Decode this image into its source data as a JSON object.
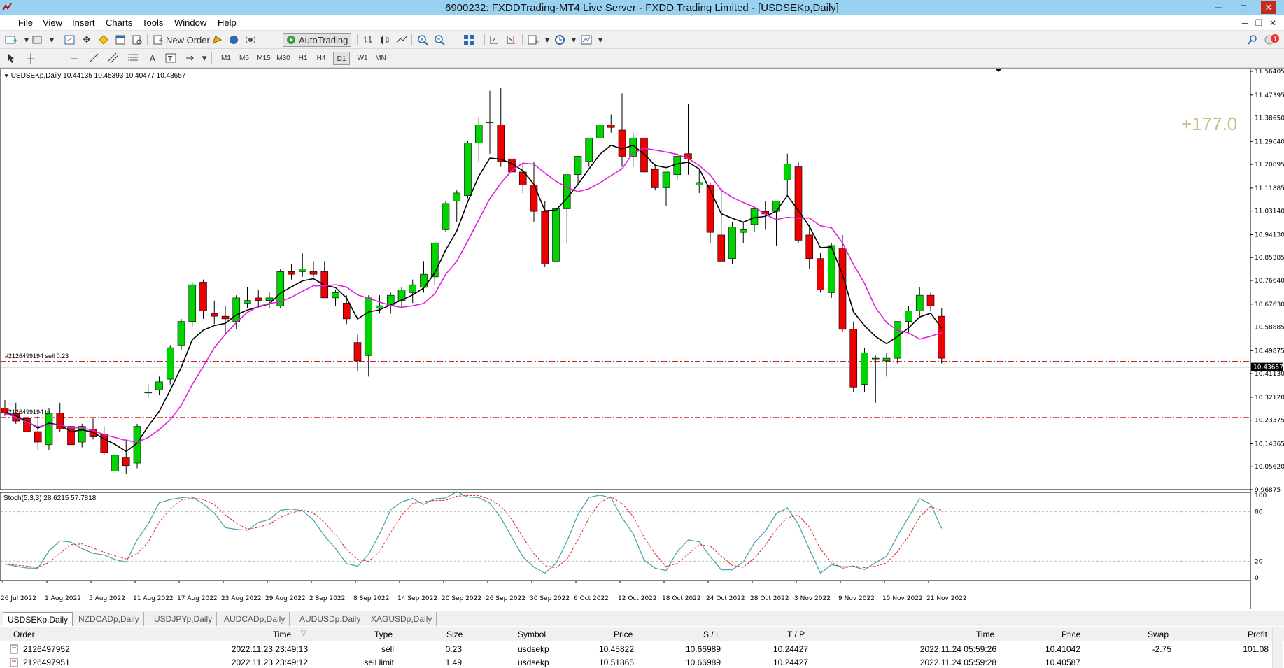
{
  "window": {
    "title": "6900232: FXDDTrading-MT4 Live Server - FXDD Trading Limited - [USDSEKp,Daily]"
  },
  "menu": [
    "File",
    "View",
    "Insert",
    "Charts",
    "Tools",
    "Window",
    "Help"
  ],
  "toolbar": {
    "new_order": "New Order",
    "autotrading": "AutoTrading"
  },
  "timeframes": [
    "M1",
    "M5",
    "M15",
    "M30",
    "H1",
    "H4",
    "D1",
    "W1",
    "MN"
  ],
  "active_timeframe": "D1",
  "chart": {
    "symbol_info": "USDSEKp,Daily  10.44135 10.45393 10.40477 10.43657",
    "profit_overlay": "+177.0",
    "order_line_label": "#2126499194 sell 0.23",
    "tp_line_label": "#2126499194 tp",
    "current_price": "10.43657",
    "price_axis": [
      "11.56405",
      "11.47395",
      "11.38650",
      "11.29640",
      "11.20895",
      "11.11885",
      "11.03140",
      "10.94130",
      "10.85385",
      "10.76640",
      "10.67630",
      "10.58885",
      "10.49875",
      "10.41130",
      "10.32120",
      "10.23375",
      "10.14365",
      "10.05620",
      "9.96875"
    ],
    "date_axis": [
      "26 Jul 2022",
      "1 Aug 2022",
      "5 Aug 2022",
      "11 Aug 2022",
      "17 Aug 2022",
      "23 Aug 2022",
      "29 Aug 2022",
      "2 Sep 2022",
      "8 Sep 2022",
      "14 Sep 2022",
      "20 Sep 2022",
      "26 Sep 2022",
      "30 Sep 2022",
      "6 Oct 2022",
      "12 Oct 2022",
      "18 Oct 2022",
      "24 Oct 2022",
      "28 Oct 2022",
      "3 Nov 2022",
      "9 Nov 2022",
      "15 Nov 2022",
      "21 Nov 2022"
    ],
    "stoch_label": "Stoch(5,3,3) 28.6215 57.7818",
    "stoch_axis": [
      "100",
      "80",
      "20",
      "0"
    ],
    "colors": {
      "bull": "#00d400",
      "bear": "#ee0000",
      "ma_fast": "#000000",
      "ma_slow": "#e020e0",
      "stoch_main": "#44a0a8",
      "stoch_signal": "#dd2222",
      "order_line": "#cc2222"
    }
  },
  "chart_data": {
    "type": "candlestick",
    "symbol": "USDSEKp",
    "timeframe": "Daily",
    "ylim": [
      9.96875,
      11.56405
    ],
    "bull_color": "#00d400",
    "bear_color": "#ee0000",
    "ohlc": [
      [
        10.28,
        10.31,
        10.25,
        10.26
      ],
      [
        10.26,
        10.3,
        10.22,
        10.23
      ],
      [
        10.24,
        10.28,
        10.18,
        10.19
      ],
      [
        10.19,
        10.25,
        10.12,
        10.15
      ],
      [
        10.14,
        10.28,
        10.12,
        10.26
      ],
      [
        10.26,
        10.3,
        10.19,
        10.2
      ],
      [
        10.21,
        10.26,
        10.13,
        10.14
      ],
      [
        10.15,
        10.22,
        10.13,
        10.21
      ],
      [
        10.2,
        10.24,
        10.16,
        10.17
      ],
      [
        10.18,
        10.21,
        10.1,
        10.11
      ],
      [
        10.04,
        10.12,
        10.02,
        10.1
      ],
      [
        10.09,
        10.16,
        10.03,
        10.06
      ],
      [
        10.07,
        10.22,
        10.05,
        10.21
      ],
      [
        10.34,
        10.37,
        10.32,
        10.34
      ],
      [
        10.35,
        10.4,
        10.33,
        10.38
      ],
      [
        10.39,
        10.52,
        10.37,
        10.51
      ],
      [
        10.52,
        10.62,
        10.5,
        10.61
      ],
      [
        10.61,
        10.76,
        10.59,
        10.75
      ],
      [
        10.76,
        10.77,
        10.62,
        10.65
      ],
      [
        10.64,
        10.69,
        10.6,
        10.63
      ],
      [
        10.63,
        10.67,
        10.56,
        10.62
      ],
      [
        10.61,
        10.71,
        10.58,
        10.7
      ],
      [
        10.68,
        10.74,
        10.66,
        10.69
      ],
      [
        10.7,
        10.73,
        10.67,
        10.69
      ],
      [
        10.69,
        10.72,
        10.66,
        10.7
      ],
      [
        10.67,
        10.81,
        10.66,
        10.8
      ],
      [
        10.8,
        10.83,
        10.77,
        10.79
      ],
      [
        10.8,
        10.87,
        10.78,
        10.81
      ],
      [
        10.8,
        10.84,
        10.78,
        10.79
      ],
      [
        10.8,
        10.84,
        10.73,
        10.7
      ],
      [
        10.7,
        10.73,
        10.67,
        10.72
      ],
      [
        10.68,
        10.71,
        10.6,
        10.62
      ],
      [
        10.53,
        10.56,
        10.42,
        10.46
      ],
      [
        10.48,
        10.71,
        10.4,
        10.7
      ],
      [
        10.66,
        10.71,
        10.64,
        10.67
      ],
      [
        10.67,
        10.72,
        10.64,
        10.71
      ],
      [
        10.69,
        10.74,
        10.66,
        10.73
      ],
      [
        10.72,
        10.77,
        10.68,
        10.75
      ],
      [
        10.74,
        10.84,
        10.72,
        10.79
      ],
      [
        10.78,
        10.87,
        10.75,
        10.91
      ],
      [
        10.96,
        11.07,
        10.95,
        11.06
      ],
      [
        11.07,
        11.11,
        10.99,
        11.1
      ],
      [
        11.09,
        11.3,
        11.08,
        11.29
      ],
      [
        11.29,
        11.39,
        11.22,
        11.36
      ],
      [
        11.37,
        11.49,
        11.25,
        11.37
      ],
      [
        11.36,
        11.5,
        11.2,
        11.22
      ],
      [
        11.23,
        11.35,
        11.17,
        11.18
      ],
      [
        11.18,
        11.21,
        11.1,
        11.13
      ],
      [
        11.13,
        11.22,
        10.99,
        11.03
      ],
      [
        11.03,
        11.07,
        10.82,
        10.83
      ],
      [
        10.84,
        11.05,
        10.81,
        11.04
      ],
      [
        11.04,
        11.09,
        10.91,
        11.17
      ],
      [
        11.17,
        11.24,
        11.13,
        11.24
      ],
      [
        11.22,
        11.29,
        11.2,
        11.31
      ],
      [
        11.31,
        11.38,
        11.24,
        11.36
      ],
      [
        11.36,
        11.4,
        11.33,
        11.35
      ],
      [
        11.34,
        11.48,
        11.2,
        11.24
      ],
      [
        11.24,
        11.33,
        11.2,
        11.31
      ],
      [
        11.31,
        11.36,
        11.26,
        11.18
      ],
      [
        11.19,
        11.21,
        11.11,
        11.12
      ],
      [
        11.12,
        11.18,
        11.05,
        11.18
      ],
      [
        11.17,
        11.25,
        11.15,
        11.24
      ],
      [
        11.25,
        11.44,
        11.17,
        11.23
      ],
      [
        11.13,
        11.19,
        11.1,
        11.14
      ],
      [
        11.13,
        11.14,
        10.91,
        10.95
      ],
      [
        10.94,
        11.12,
        10.85,
        10.84
      ],
      [
        10.85,
        10.99,
        10.83,
        10.97
      ],
      [
        10.95,
        10.99,
        10.91,
        10.96
      ],
      [
        10.98,
        11.04,
        10.95,
        11.04
      ],
      [
        11.03,
        11.07,
        10.96,
        11.02
      ],
      [
        11.03,
        11.06,
        10.9,
        11.07
      ],
      [
        11.15,
        11.25,
        11.09,
        11.21
      ],
      [
        11.2,
        11.22,
        10.91,
        10.92
      ],
      [
        10.94,
        10.98,
        10.81,
        10.85
      ],
      [
        10.85,
        10.87,
        10.72,
        10.73
      ],
      [
        10.72,
        10.91,
        10.7,
        10.9
      ],
      [
        10.89,
        10.94,
        10.57,
        10.58
      ],
      [
        10.58,
        10.61,
        10.34,
        10.36
      ],
      [
        10.37,
        10.51,
        10.34,
        10.49
      ],
      [
        10.47,
        10.48,
        10.3,
        10.47
      ],
      [
        10.46,
        10.49,
        10.4,
        10.47
      ],
      [
        10.47,
        10.61,
        10.45,
        10.61
      ],
      [
        10.61,
        10.67,
        10.57,
        10.65
      ],
      [
        10.65,
        10.74,
        10.63,
        10.71
      ],
      [
        10.71,
        10.72,
        10.65,
        10.67
      ],
      [
        10.63,
        10.66,
        10.45,
        10.47
      ]
    ],
    "series": [
      {
        "name": "",
        "type": "ma_fast"
      },
      {
        "name": "",
        "type": "ma_slow"
      }
    ],
    "stochastic": {
      "params": "(5,3,3)",
      "main": 28.6215,
      "signal": 57.7818,
      "ylim": [
        0,
        100
      ],
      "levels": [
        20,
        80
      ]
    },
    "orders": [
      {
        "label": "#2126499194 sell 0.23",
        "price": 10.45822,
        "style": "dash-dot"
      },
      {
        "label": "#2126499194 tp",
        "price": 10.24427,
        "style": "dash-dot"
      }
    ]
  },
  "tabs": [
    "USDSEKp,Daily",
    "NZDCADp,Daily",
    "USDJPYp,Daily",
    "AUDCADp,Daily",
    "AUDUSDp,Daily",
    "XAGUSDp,Daily"
  ],
  "active_tab": "USDSEKp,Daily",
  "terminal": {
    "headers": [
      "Order",
      "Time",
      "Type",
      "Size",
      "Symbol",
      "Price",
      "S / L",
      "T / P",
      "Time",
      "Price",
      "Swap",
      "Profit"
    ],
    "rows": [
      [
        "2126497952",
        "2022.11.23 23:49:13",
        "sell",
        "0.23",
        "usdsekp",
        "10.45822",
        "10.66989",
        "10.24427",
        "2022.11.24 05:59:26",
        "10.41042",
        "-2.75",
        "101.08"
      ],
      [
        "2126497951",
        "2022.11.23 23:49:12",
        "sell limit",
        "1.49",
        "usdsekp",
        "10.51865",
        "10.66989",
        "10.24427",
        "2022.11.24 05:59:28",
        "10.40587",
        "",
        ""
      ]
    ]
  }
}
